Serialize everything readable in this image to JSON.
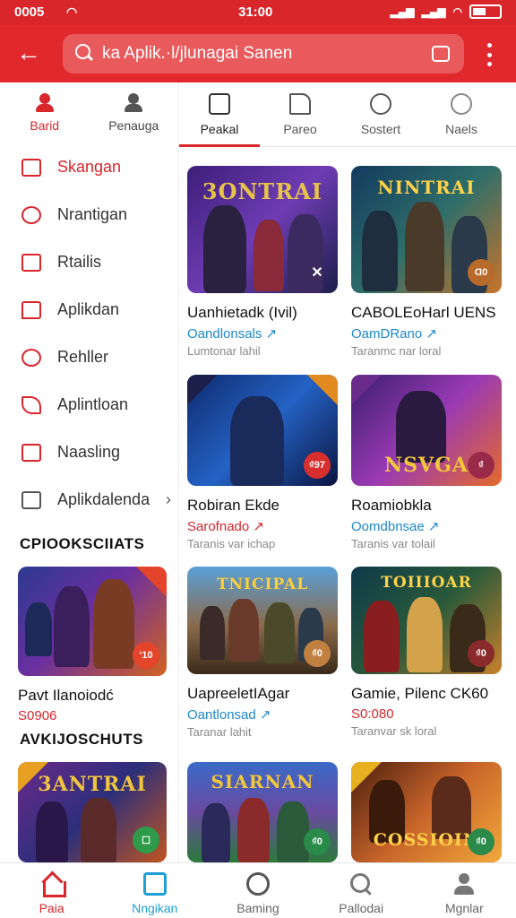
{
  "status_bar": {
    "left": "0005",
    "sup": "5",
    "time": "31:00"
  },
  "search": {
    "text": "ka Aplik.·l/jlunagai Sanen"
  },
  "side_tabs": [
    {
      "label": "Barid",
      "icon": "user-icon"
    },
    {
      "label": "Penauga",
      "icon": "person-icon"
    }
  ],
  "side_menu": [
    {
      "label": "Skangan",
      "icon": "square-icon"
    },
    {
      "label": "Nrantigan",
      "icon": "search-icon"
    },
    {
      "label": "Rtailis",
      "icon": "square-icon"
    },
    {
      "label": "Aplikdan",
      "icon": "chat-icon"
    },
    {
      "label": "Rehller",
      "icon": "heart-icon"
    },
    {
      "label": "Aplintloan",
      "icon": "send-icon"
    },
    {
      "label": "Naasling",
      "icon": "folder-icon"
    },
    {
      "label": "Aplikdalenda",
      "icon": "copy-icon",
      "chevron": "›"
    }
  ],
  "sections": [
    {
      "title": "CPIOOKSCIIATS"
    },
    {
      "title": "AVKIJOSCHUTS"
    }
  ],
  "side_cards": [
    {
      "title": "Pavt Ilanoiodć",
      "price": "S0906",
      "price_color": "red",
      "badge": "ʻ10"
    },
    {
      "title": "",
      "price": "",
      "price_color": "red",
      "badge": "☐",
      "logo": "3ANTRAI"
    }
  ],
  "tabs": [
    {
      "label": "Peakal"
    },
    {
      "label": "Pareo"
    },
    {
      "label": "Sostert"
    },
    {
      "label": "Naels"
    }
  ],
  "grid": [
    {
      "title": "Uanhietadk (Ivil)",
      "price": "Oandlonsals ↗",
      "price_color": "blue",
      "sub": "Lumtonar lahil",
      "logo": "3ONTRAI",
      "badge": "✕"
    },
    {
      "title": "CABOLEoHarl UENS",
      "price": "OamDRano ↗",
      "price_color": "blue",
      "sub": "Taranmc nar loral",
      "logo": "NINTRAI",
      "badge": "Ɑ0"
    },
    {
      "title": "Robiran Ekde",
      "price": "Sarofnado ↗",
      "price_color": "red",
      "sub": "Taranis var ichap",
      "logo": "",
      "badge": "₫97"
    },
    {
      "title": "Roamiobkla",
      "price": "Oomdbnsae ↗",
      "price_color": "blue",
      "sub": "Taranis var tolail",
      "logo": "NSVGA",
      "badge": "₫"
    },
    {
      "title": "UapreeletIAgar",
      "price": "Oantlonsad ↗",
      "price_color": "blue",
      "sub": "Taranar lahit",
      "logo": "TNICIPAL",
      "badge": "₫0"
    },
    {
      "title": "Gamie, Pilenc CK60",
      "price": "S0:080",
      "price_color": "red",
      "sub": "Taranvar sk loral",
      "logo": "TOIIIOAR",
      "badge": "₫0"
    },
    {
      "title": "",
      "price": "",
      "price_color": "blue",
      "sub": "",
      "logo": "SIARNAN",
      "badge": "₫0"
    },
    {
      "title": "",
      "price": "",
      "price_color": "blue",
      "sub": "",
      "logo": "COSSIOIN",
      "badge": "₫0"
    }
  ],
  "bottom_nav": [
    {
      "label": "Paia"
    },
    {
      "label": "Nngikan"
    },
    {
      "label": "Baming"
    },
    {
      "label": "Pallodai"
    },
    {
      "label": "Mgnlar"
    }
  ]
}
